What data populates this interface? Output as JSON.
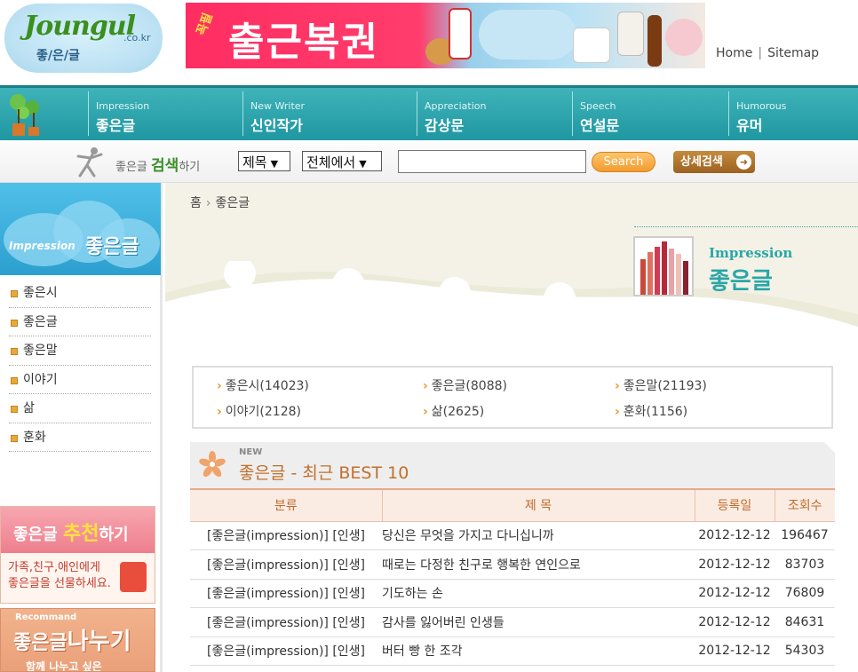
{
  "header": {
    "logo_main": "Joungul",
    "logo_domain": ".co.kr",
    "logo_sub": "좋/은/글",
    "banner_tag": "꼭필",
    "banner_text": "출근복권",
    "links": [
      "Home",
      "Sitemap"
    ]
  },
  "nav": {
    "items": [
      {
        "en": "Impression",
        "ko": "좋은글"
      },
      {
        "en": "New Writer",
        "ko": "신인작가"
      },
      {
        "en": "Appreciation",
        "ko": "감상문"
      },
      {
        "en": "Speech",
        "ko": "연설문"
      },
      {
        "en": "Humorous",
        "ko": "유머"
      }
    ]
  },
  "search": {
    "title_prefix": "좋은글",
    "title_bold": "검색",
    "title_suffix": "하기",
    "field_select": "제목",
    "scope_select": "전체에서",
    "query_value": "",
    "search_button": "Search",
    "advanced_button": "상세검색"
  },
  "sidebar": {
    "head_en": "Impression",
    "head_ko": "좋은글",
    "items": [
      {
        "label": "좋은시"
      },
      {
        "label": "좋은글"
      },
      {
        "label": "좋은말"
      },
      {
        "label": "이야기"
      },
      {
        "label": "삶"
      },
      {
        "label": "훈화"
      }
    ],
    "promo1": {
      "title_a": "좋은글",
      "title_b": "추천",
      "title_c": "하기",
      "line1": "가족,친구,애인에게",
      "line2": "좋은글을 선물하세요."
    },
    "promo2": {
      "en": "Recommand",
      "title_a": "좋은글",
      "title_b": "나누기",
      "sub": "함께 나누고 싶은"
    }
  },
  "main": {
    "breadcrumb": [
      "홈",
      "좋은글"
    ],
    "hero_en": "Impression",
    "hero_ko": "좋은글",
    "categories": [
      {
        "label": "좋은시(14023)"
      },
      {
        "label": "좋은글(8088)"
      },
      {
        "label": "좋은말(21193)"
      },
      {
        "label": "이야기(2128)"
      },
      {
        "label": "삶(2625)"
      },
      {
        "label": "훈화(1156)"
      }
    ],
    "best": {
      "new_label": "NEW",
      "title": "좋은글 - 최근 BEST 10",
      "columns": [
        "분류",
        "제 목",
        "등록일",
        "조회수"
      ],
      "rows": [
        {
          "category": "[좋은글(impression)] [인생]",
          "title": "당신은 무엇을 가지고 다니십니까",
          "date": "2012-12-12",
          "views": "196467"
        },
        {
          "category": "[좋은글(impression)] [인생]",
          "title": "때로는 다정한 친구로 행복한 연인으로",
          "date": "2012-12-12",
          "views": "83703"
        },
        {
          "category": "[좋은글(impression)] [인생]",
          "title": "기도하는 손",
          "date": "2012-12-12",
          "views": "76809"
        },
        {
          "category": "[좋은글(impression)] [인생]",
          "title": "감사를 잃어버린 인생들",
          "date": "2012-12-12",
          "views": "84631"
        },
        {
          "category": "[좋은글(impression)] [인생]",
          "title": "버터 빵 한 조각",
          "date": "2012-12-12",
          "views": "54303"
        }
      ]
    }
  },
  "colors": {
    "nav_teal": "#1f97a1",
    "accent_orange": "#c0702c",
    "hero_teal": "#2aa6a8"
  }
}
